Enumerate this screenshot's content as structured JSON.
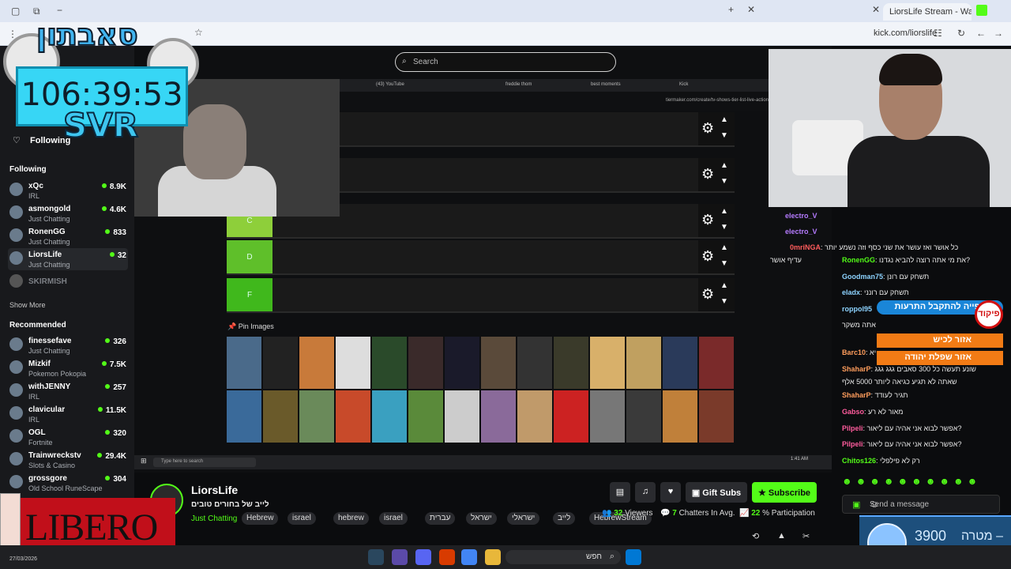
{
  "browser": {
    "active_tab_title": "LiorsLife Stream - Watch Li",
    "url": "kick.com/liorslife"
  },
  "overlays": {
    "timer": "106:39:53",
    "timer_tag": "SVR",
    "logo_text": "סאבתון",
    "libero": "LIBERO",
    "goal_value": "3900",
    "goal_sub": "3728",
    "goal_label": "מטרה –",
    "alert_title": "צפייה להתקבל התרעות",
    "alert_line2": "אזור לכיש",
    "alert_line3": "אזור שפלת יהודה",
    "alert_logo": "פיקוד"
  },
  "sidebar": {
    "following_label": "Following",
    "section_following": "Following",
    "following": [
      {
        "name": "xQc",
        "category": "IRL",
        "viewers": "8.9K"
      },
      {
        "name": "asmongold",
        "category": "Just Chatting",
        "viewers": "4.6K"
      },
      {
        "name": "RonenGG",
        "category": "Just Chatting",
        "viewers": "833"
      },
      {
        "name": "LiorsLife",
        "category": "Just Chatting",
        "viewers": "32"
      }
    ],
    "offline_channel": "SKIRMISH",
    "show_more": "Show More",
    "section_recommended": "Recommended",
    "recommended": [
      {
        "name": "finessefave",
        "category": "Just Chatting",
        "viewers": "326"
      },
      {
        "name": "Mizkif",
        "category": "Pokemon Pokopia",
        "viewers": "7.5K"
      },
      {
        "name": "withJENNY",
        "category": "IRL",
        "viewers": "257"
      },
      {
        "name": "clavicular",
        "category": "IRL",
        "viewers": "11.5K"
      },
      {
        "name": "OGL",
        "category": "Fortnite",
        "viewers": "320"
      },
      {
        "name": "Trainwreckstv",
        "category": "Slots & Casino",
        "viewers": "29.4K"
      },
      {
        "name": "grossgore",
        "category": "Old School RuneScape",
        "viewers": "304"
      }
    ]
  },
  "stream_view": {
    "search_placeholder": "Search",
    "inner_tabs": [
      "(43) YouTube",
      "freddie thom",
      "best moments",
      "Kick"
    ],
    "inner_url": "tiermaker.com/create/tv-shows-tier-list-live-action",
    "tiers": [
      "",
      "",
      "C",
      "D",
      "F"
    ],
    "tier_colors": [
      "#7fff7f",
      "#7fff7f",
      "#8ecf3a",
      "#5fbf2a",
      "#40b81c"
    ],
    "pin_images": "Pin Images",
    "taskbar_search": "Type here to search",
    "taskbar_time": "1:41 AM",
    "taskbar_date": "3/27/2026",
    "poster_colors": [
      "#4a6a8a",
      "#222",
      "#c87a3a",
      "#ddd",
      "#2a4a2a",
      "#3a2a2a",
      "#1a1a2a",
      "#5a4a3a",
      "#333",
      "#3a3a2a",
      "#d8b06a",
      "#c0a060",
      "#2a3a5a",
      "#7a2a2a",
      "#3a6a9a",
      "#6a5a2a",
      "#6a8a5a",
      "#c84a2a",
      "#3aa0c0",
      "#5a8a3a",
      "#cccccc",
      "#8a6a9a",
      "#c09a6a",
      "#cc2222",
      "#777",
      "#3a3a3a",
      "#c0803a",
      "#7a3a2a"
    ]
  },
  "chat": {
    "messages": [
      {
        "user": "electro_V",
        "text": "",
        "color": "#b57bff"
      },
      {
        "user": "electro_V",
        "text": "",
        "color": "#b57bff"
      },
      {
        "user": "0mriNGA",
        "text": "כל אושר ואז עושר את שני כסף וזה נשמע יותר",
        "color": "#ff5c5c"
      },
      {
        "user": "",
        "text": "עדיף אושר",
        "color": "#ffffff"
      },
      {
        "user": "RonenGG",
        "text": "את מי אתה רוצה להביא נגדנו?",
        "color": "#53fc18"
      },
      {
        "user": "Goodman75",
        "text": "תשחק עם רונן",
        "color": "#8dd3ff"
      },
      {
        "user": "eladx",
        "text": "תשחק עם רונני",
        "color": "#8dd3ff"
      },
      {
        "user": "roppol95",
        "text": "",
        "color": "#8dd3ff"
      },
      {
        "user": "",
        "text": "אתה משקר",
        "color": "#ffffff"
      },
      {
        "user": "Barc10",
        "text": "יא",
        "color": "#ff9d5c"
      },
      {
        "user": "ShaharP",
        "text": "שונע תעשה כל 300 סאבים גגג גגג",
        "color": "#ff9d5c"
      },
      {
        "user": "",
        "text": "שאתה לא תגיע כגיאה ליותר 5000 אלף",
        "color": "#ffffff"
      },
      {
        "user": "ShaharP",
        "text": "תגיר לעודד",
        "color": "#ff9d5c"
      },
      {
        "user": "Gabso",
        "text": "מאור לא רע",
        "color": "#ff5c9d"
      },
      {
        "user": "Pilpeli",
        "text": "אפשר לבוא אני אהיה עם ליאור?",
        "color": "#ff5c9d"
      },
      {
        "user": "Pilpeli",
        "text": "אפשר לבוא אני אהיה עם ליאור?",
        "color": "#ff5c9d"
      },
      {
        "user": "Chitos126",
        "text": "רק לא פילפלי",
        "color": "#53fc18"
      }
    ],
    "send_placeholder": "Send a message"
  },
  "info": {
    "streamer": "LiorsLife",
    "title": "לייב של בחורים טובים",
    "category": "Just Chatting",
    "tags": [
      "Hebrew",
      "israel",
      "hebrew",
      "israel",
      "עברית",
      "ישראל",
      "ישראלי",
      "לייב",
      "HebrewStream"
    ],
    "gift_subs": "Gift Subs",
    "subscribe": "Subscribe",
    "viewers": "32",
    "viewers_label": "Viewers",
    "chatters": "7",
    "chatters_label": "Chatters In Avg.",
    "participation": "22",
    "participation_label": "% Participation"
  },
  "windows_taskbar": {
    "search_text": "חפש",
    "date": "27/03/2026"
  },
  "colors": {
    "accent": "#53fc18",
    "background": "#0b0c0e",
    "sidebar": "#18191c"
  }
}
